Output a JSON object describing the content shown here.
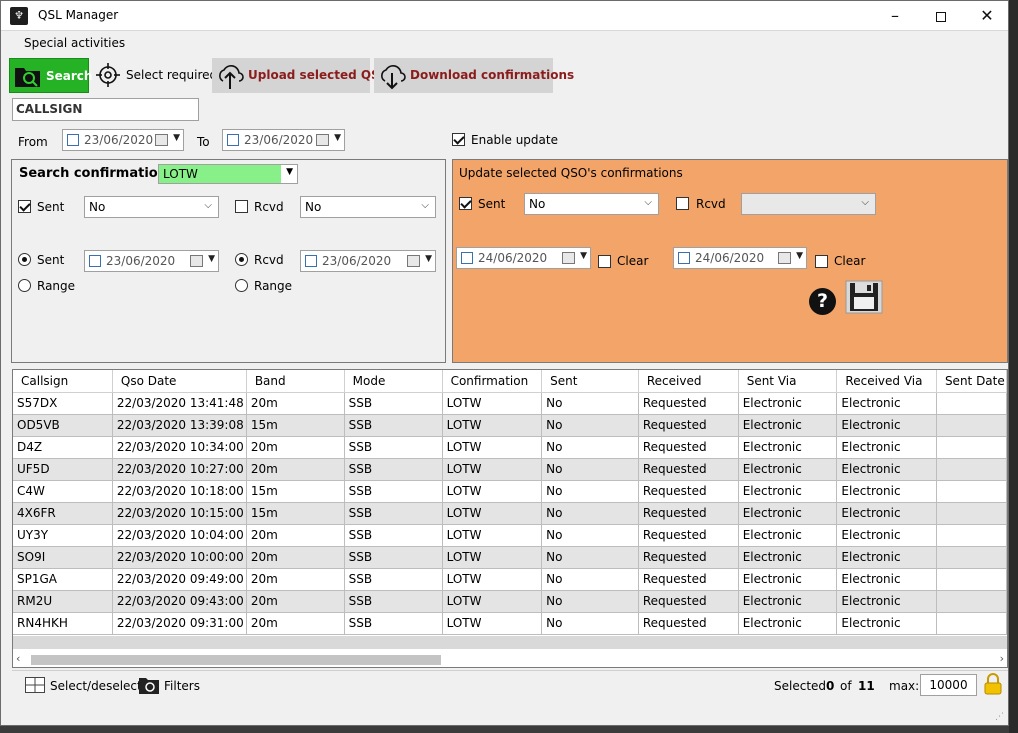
{
  "window": {
    "title": "QSL Manager"
  },
  "menu": {
    "items": [
      "Special activities"
    ]
  },
  "toolbar": {
    "search": "Search",
    "select_required": "Select required",
    "upload": "Upload selected QSO",
    "download": "Download confirmations"
  },
  "callsign": {
    "placeholder": "CALLSIGN"
  },
  "date_range": {
    "from_label": "From",
    "from_value": "23/06/2020",
    "to_label": "To",
    "to_value": "23/06/2020",
    "enable_update_label": "Enable update"
  },
  "search_panel": {
    "title": "Search confirmation",
    "type_value": "LOTW",
    "sent_label": "Sent",
    "sent_value": "No",
    "rcvd_label": "Rcvd",
    "rcvd_value": "No",
    "sent_radio_label": "Sent",
    "sent_date": "23/06/2020",
    "rcvd_radio_label": "Rcvd",
    "rcvd_date": "23/06/2020",
    "range_label_1": "Range",
    "range_label_2": "Range"
  },
  "update_panel": {
    "title": "Update selected QSO's confirmations",
    "sent_label": "Sent",
    "sent_value": "No",
    "rcvd_label": "Rcvd",
    "rcvd_value": "",
    "date1": "24/06/2020",
    "clear1": "Clear",
    "date2": "24/06/2020",
    "clear2": "Clear"
  },
  "grid": {
    "columns": [
      "Callsign",
      "Qso Date",
      "Band",
      "Mode",
      "Confirmation",
      "Sent",
      "Received",
      "Sent Via",
      "Received Via",
      "Sent Date"
    ],
    "rows": [
      [
        "S57DX",
        "22/03/2020 13:41:48",
        "20m",
        "SSB",
        "LOTW",
        "No",
        "Requested",
        "Electronic",
        "Electronic",
        ""
      ],
      [
        "OD5VB",
        "22/03/2020 13:39:08",
        "15m",
        "SSB",
        "LOTW",
        "No",
        "Requested",
        "Electronic",
        "Electronic",
        ""
      ],
      [
        "D4Z",
        "22/03/2020 10:34:00",
        "20m",
        "SSB",
        "LOTW",
        "No",
        "Requested",
        "Electronic",
        "Electronic",
        ""
      ],
      [
        "UF5D",
        "22/03/2020 10:27:00",
        "20m",
        "SSB",
        "LOTW",
        "No",
        "Requested",
        "Electronic",
        "Electronic",
        ""
      ],
      [
        "C4W",
        "22/03/2020 10:18:00",
        "15m",
        "SSB",
        "LOTW",
        "No",
        "Requested",
        "Electronic",
        "Electronic",
        ""
      ],
      [
        "4X6FR",
        "22/03/2020 10:15:00",
        "15m",
        "SSB",
        "LOTW",
        "No",
        "Requested",
        "Electronic",
        "Electronic",
        ""
      ],
      [
        "UY3Y",
        "22/03/2020 10:04:00",
        "20m",
        "SSB",
        "LOTW",
        "No",
        "Requested",
        "Electronic",
        "Electronic",
        ""
      ],
      [
        "SO9I",
        "22/03/2020 10:00:00",
        "20m",
        "SSB",
        "LOTW",
        "No",
        "Requested",
        "Electronic",
        "Electronic",
        ""
      ],
      [
        "SP1GA",
        "22/03/2020 09:49:00",
        "20m",
        "SSB",
        "LOTW",
        "No",
        "Requested",
        "Electronic",
        "Electronic",
        ""
      ],
      [
        "RM2U",
        "22/03/2020 09:43:00",
        "20m",
        "SSB",
        "LOTW",
        "No",
        "Requested",
        "Electronic",
        "Electronic",
        ""
      ],
      [
        "RN4HKH",
        "22/03/2020 09:31:00",
        "20m",
        "SSB",
        "LOTW",
        "No",
        "Requested",
        "Electronic",
        "Electronic",
        ""
      ]
    ]
  },
  "status": {
    "select_deselect": "Select/deselect",
    "filters": "Filters",
    "selected_label": "Selected",
    "selected_count": "0",
    "of_label": "of",
    "total": "11",
    "max_label": "max:",
    "max_value": "10000"
  },
  "colors": {
    "search_button": "#25b325",
    "update_panel": "#f3a469",
    "upload_text": "#8b1c1c",
    "lotw_highlight": "#88f088"
  }
}
